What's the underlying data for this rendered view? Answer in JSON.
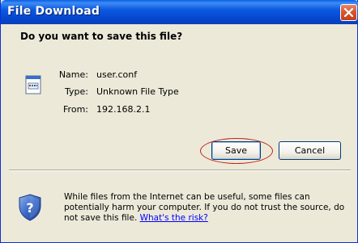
{
  "window": {
    "title": "File Download",
    "close_icon": "close-x-icon"
  },
  "prompt": {
    "question": "Do you want to save this file?"
  },
  "file_info": {
    "icon": "unknown-file-icon",
    "name_label": "Name:",
    "name_value": "user.conf",
    "type_label": "Type:",
    "type_value": "Unknown File Type",
    "from_label": "From:",
    "from_value": "192.168.2.1"
  },
  "buttons": {
    "save_label": "Save",
    "cancel_label": "Cancel"
  },
  "warning": {
    "icon": "security-shield-question-icon",
    "text": "While files from the Internet can be useful, some files can potentially harm your computer. If you do not trust the source, do not save this file. ",
    "link_text": "What's the risk?"
  },
  "colors": {
    "titlebar": "#0646cf",
    "dialog_bg": "#ece9d8",
    "close_button": "#d9572e",
    "highlight_ring": "#c0221b",
    "link": "#0000ff"
  }
}
